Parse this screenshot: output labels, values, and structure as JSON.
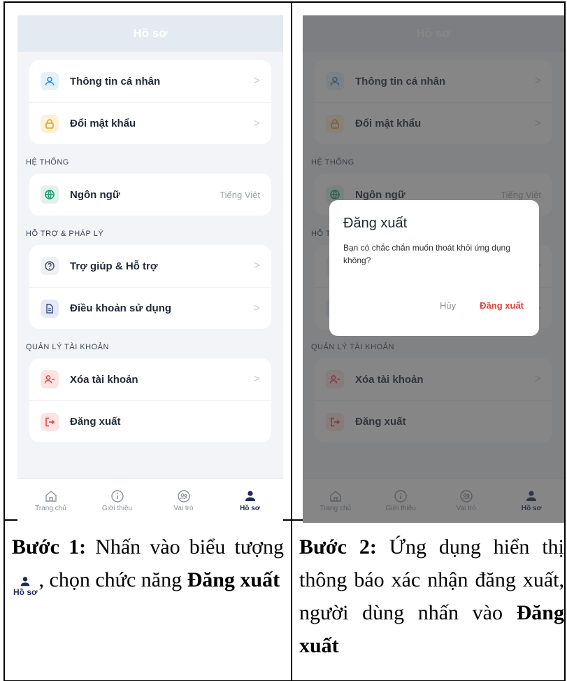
{
  "screen": {
    "header_title": "Hồ sơ",
    "personal_info": "Thông tin cá nhân",
    "change_password": "Đổi mật khẩu",
    "section_system": "HỆ THỐNG",
    "language_label": "Ngôn ngữ",
    "language_value": "Tiếng Việt",
    "section_support": "HỖ TRỢ & PHÁP LÝ",
    "help_support": "Trợ giúp & Hỗ trợ",
    "terms": "Điều khoản sử dụng",
    "section_account": "QUẢN LÝ TÀI KHOẢN",
    "delete_account": "Xóa tài khoản",
    "logout": "Đăng xuất",
    "chevron": ">",
    "nav": {
      "home": "Trang chủ",
      "intro": "Giới thiệu",
      "role": "Vai trò",
      "profile": "Hồ sơ"
    }
  },
  "dialog": {
    "title": "Đăng xuất",
    "message": "Bạn có chắc chắn muốn thoát khỏi ứng dụng không?",
    "cancel": "Hủy",
    "confirm": "Đăng xuất"
  },
  "captions": {
    "step1_label": "Bước 1:",
    "step1_text_a": "Nhấn vào biểu tượng",
    "step1_icon_label": "Hồ sơ",
    "step1_text_b": ", chọn chức năng",
    "step1_bold": "Đăng xuất",
    "step2_label": "Bước 2:",
    "step2_text": "Ứng dụng hiển thị thông báo xác nhận đăng xuất, người dùng nhấn vào",
    "step2_bold": "Đăng xuất"
  },
  "colors": {
    "danger": "#e0413b",
    "nav_active": "#1d2a5e",
    "overlay": "rgba(60,60,60,0.62)"
  },
  "icons": [
    "user-icon",
    "lock-icon",
    "globe-icon",
    "help-icon",
    "document-icon",
    "user-minus-icon",
    "logout-icon",
    "home-icon",
    "info-icon",
    "role-icon",
    "profile-icon"
  ]
}
